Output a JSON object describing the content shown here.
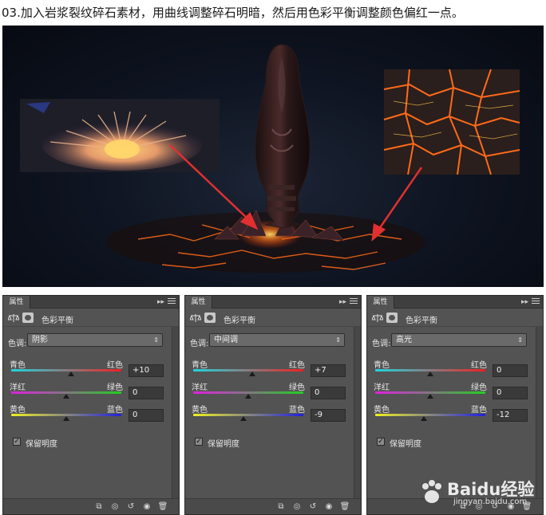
{
  "caption": "03.加入岩浆裂纹碎石素材，用曲线调整碎石明暗，然后用色彩平衡调整颜色偏红一点。",
  "panels": [
    {
      "tab": "属性",
      "collapse": "▸▸",
      "title": "色彩平衡",
      "tone_label": "色调:",
      "tone_value": "阴影",
      "rows": [
        {
          "left": "青色",
          "right": "红色",
          "value": "+10",
          "level": 0.04
        },
        {
          "left": "洋红",
          "right": "绿色",
          "value": "0",
          "level": 0.0
        },
        {
          "left": "黄色",
          "right": "蓝色",
          "value": "0",
          "level": 0.0
        }
      ],
      "preserve_label": "保留明度"
    },
    {
      "tab": "属性",
      "collapse": "▸▸",
      "title": "色彩平衡",
      "tone_label": "色调:",
      "tone_value": "中间调",
      "rows": [
        {
          "left": "青色",
          "right": "红色",
          "value": "+7",
          "level": 0.035
        },
        {
          "left": "洋红",
          "right": "绿色",
          "value": "0",
          "level": 0.0
        },
        {
          "left": "黄色",
          "right": "蓝色",
          "value": "-9",
          "level": -0.045
        }
      ],
      "preserve_label": "保留明度"
    },
    {
      "tab": "属性",
      "collapse": "▸▸",
      "title": "色彩平衡",
      "tone_label": "色调:",
      "tone_value": "高光",
      "rows": [
        {
          "left": "青色",
          "right": "红色",
          "value": "0",
          "level": 0.0
        },
        {
          "left": "洋红",
          "right": "绿色",
          "value": "0",
          "level": 0.0
        },
        {
          "left": "黄色",
          "right": "蓝色",
          "value": "-12",
          "level": -0.06
        }
      ],
      "preserve_label": "保留明度"
    }
  ],
  "footer_icons": [
    "clip-icon",
    "visibility-cycle-icon",
    "reset-icon",
    "eye-icon",
    "trash-icon"
  ],
  "watermark": {
    "brand": "Baidu经验",
    "sub": "jingyan.baidu.com"
  },
  "colors": {
    "panel_bg": "#535353",
    "lava": "#ff5a14",
    "arrow": "#e03030"
  }
}
